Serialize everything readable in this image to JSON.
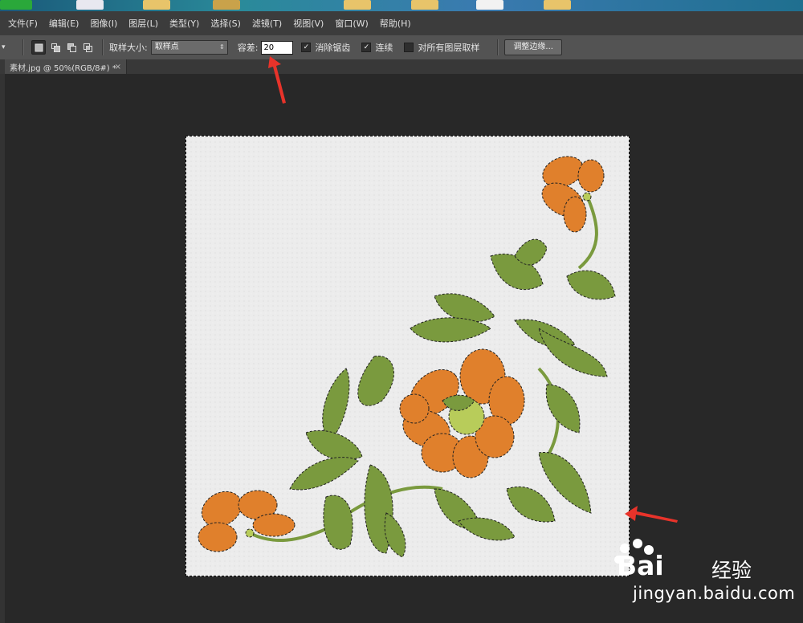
{
  "menu": {
    "items": [
      "文件(F)",
      "编辑(E)",
      "图像(I)",
      "图层(L)",
      "类型(Y)",
      "选择(S)",
      "滤镜(T)",
      "视图(V)",
      "窗口(W)",
      "帮助(H)"
    ]
  },
  "options": {
    "sample_size_label": "取样大小:",
    "sample_size_value": "取样点",
    "tolerance_label": "容差:",
    "tolerance_value": "20",
    "antialias_label": "消除锯齿",
    "contiguous_label": "连续",
    "sample_all_layers_label": "对所有图层取样",
    "refine_edge_label": "调整边缘...",
    "check_mark": "✓",
    "dropdown_arrow": "⇕",
    "tool_arrow": "▾"
  },
  "document": {
    "tab_title": "素材.jpg @ 50%(RGB/8#) *",
    "close_glyph": "×"
  },
  "watermark": {
    "brand": "Bai",
    "brand2": "经验",
    "url": "jingyan.baidu.com"
  },
  "colors": {
    "petal": "#e0802c",
    "leaf": "#7a9a3e",
    "annotation_arrow": "#e8332a"
  }
}
